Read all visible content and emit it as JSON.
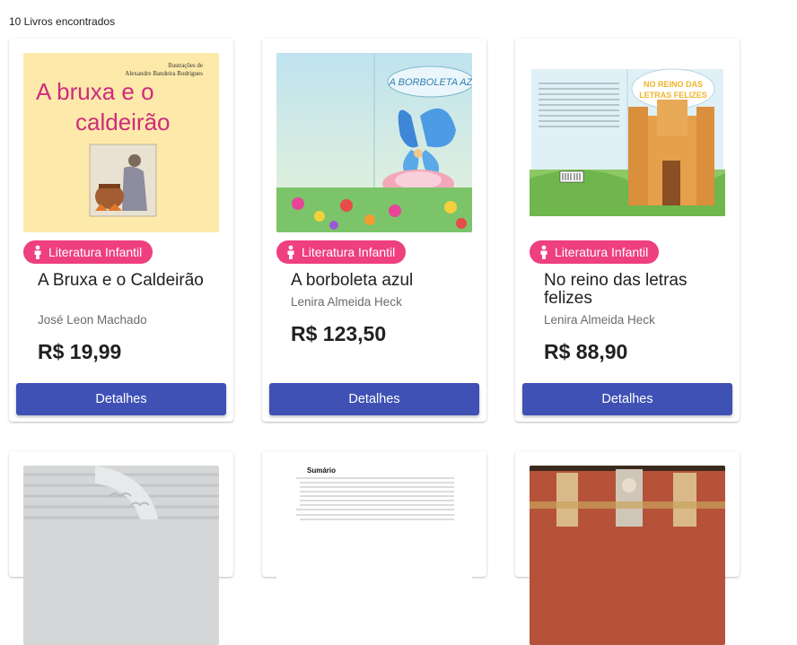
{
  "results": {
    "count_label": "10 Livros encontrados"
  },
  "books": [
    {
      "category": "Literatura Infantil",
      "title": "A Bruxa e o Caldeirão",
      "author": "José Leon Machado",
      "price": "R$ 19,99",
      "button": "Detalhes",
      "cover_text": {
        "credit_line1": "Ilustrações de",
        "credit_line2": "Alexandre Bandeira Rodrigues",
        "title_line1": "A bruxa e o",
        "title_line2": "caldeirão"
      }
    },
    {
      "category": "Literatura Infantil",
      "title": "A borboleta azul",
      "author": "Lenira Almeida Heck",
      "price": "R$ 123,50",
      "button": "Detalhes",
      "cover_text": {
        "title": "A BORBOLETA AZ"
      }
    },
    {
      "category": "Literatura Infantil",
      "title": "No reino das letras felizes",
      "author": "Lenira Almeida Heck",
      "price": "R$ 88,90",
      "button": "Detalhes",
      "cover_text": {
        "title_line1": "NO REINO DAS",
        "title_line2": "LETRAS FELIZES"
      }
    }
  ],
  "row2_covers": {
    "summary_heading": "Sumário"
  },
  "colors": {
    "chip": "#ee3f7e",
    "button": "#3f51b5"
  }
}
